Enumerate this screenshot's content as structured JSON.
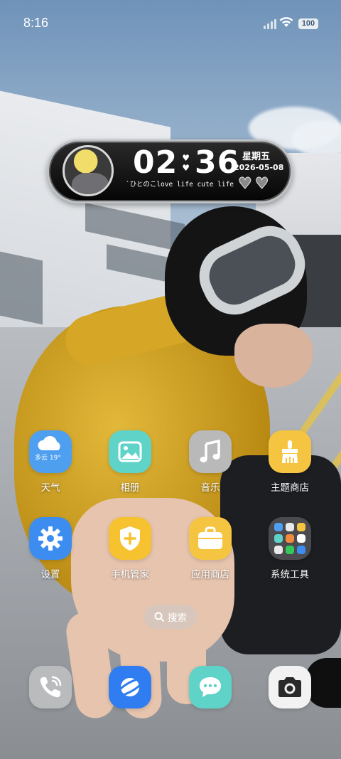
{
  "status_bar": {
    "time": "8:16",
    "battery": "100"
  },
  "widget": {
    "hours": "02",
    "minutes": "36",
    "weekday": "星期五",
    "date": "2026-05-08",
    "tagline": "`ひとのこlove life cute life",
    "heart_icon": "♥"
  },
  "apps": {
    "weather": {
      "label": "天气",
      "icon_text": "多云 19°",
      "icon": "cloud-icon",
      "color": "#4f9ff0"
    },
    "gallery": {
      "label": "相册",
      "icon": "picture-icon",
      "color": "#5fd3c7"
    },
    "music": {
      "label": "音乐",
      "icon": "music-note-icon",
      "color": "#b9b9b9"
    },
    "themes": {
      "label": "主题商店",
      "icon": "paintbrush-icon",
      "color": "#f5c542"
    },
    "settings": {
      "label": "设置",
      "icon": "gear-icon",
      "color": "#3d8df0"
    },
    "security": {
      "label": "手机管家",
      "icon": "shield-icon",
      "color": "#f6c230"
    },
    "appstore": {
      "label": "应用商店",
      "icon": "bag-icon",
      "color": "#f5c542"
    },
    "tools": {
      "label": "系统工具",
      "icon": "folder-icon",
      "color": "#6e6e6e"
    }
  },
  "search": {
    "label": "搜索",
    "icon": "search-icon"
  },
  "dock": {
    "phone": {
      "icon": "phone-icon",
      "color": "#b9bbbd"
    },
    "browser": {
      "icon": "browser-icon",
      "color": "#2f7df0"
    },
    "messages": {
      "icon": "message-icon",
      "color": "#5fd3c7"
    },
    "camera": {
      "icon": "camera-icon",
      "color": "#f2f2f2"
    }
  }
}
